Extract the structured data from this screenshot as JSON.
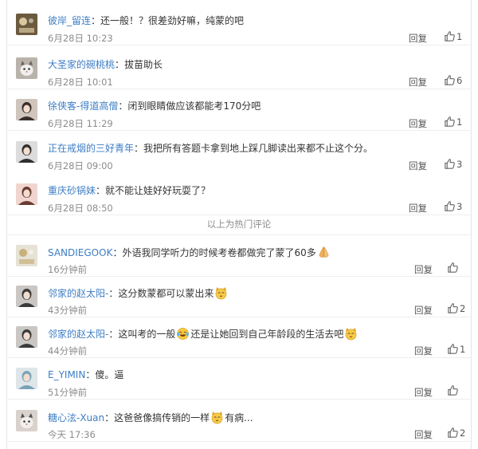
{
  "hot_label": "以上为热门评论",
  "reply_label": "回复",
  "comments": [
    {
      "user": "彼岸_留连",
      "sep": "：",
      "text": "还一般！？很差劲好嘛，纯蒙的吧",
      "text2": "",
      "time": "6月28日 10:23",
      "likes": "1",
      "emoji1": "",
      "emoji2": ""
    },
    {
      "user": "大圣家的碗桃桃",
      "sep": "：",
      "text": "拔苗助长",
      "text2": "",
      "time": "6月28日 10:01",
      "likes": "6",
      "emoji1": "",
      "emoji2": ""
    },
    {
      "user": "徐侠客-得道高僧",
      "sep": "：",
      "text": "闭到眼睛做应该都能考170分吧",
      "text2": "",
      "time": "6月28日 11:29",
      "likes": "1",
      "emoji1": "",
      "emoji2": ""
    },
    {
      "user": "正在戒烟的三好青年",
      "sep": "：",
      "text": "我把所有答题卡拿到地上踩几脚读出来都不止这个分。",
      "text2": "",
      "time": "6月28日 09:00",
      "likes": "3",
      "emoji1": "",
      "emoji2": ""
    },
    {
      "user": "重庆砂锅妹",
      "sep": "：",
      "text": "就不能让娃好好玩耍了？",
      "text2": "",
      "time": "6月28日 08:50",
      "likes": "3",
      "emoji1": "",
      "emoji2": ""
    },
    {
      "user": "SANDIEGOOK",
      "sep": "：",
      "text": "外语我同学听力的时候考卷都做完了蒙了60多",
      "text2": "",
      "time": "16分钟前",
      "likes": "",
      "emoji1": "pray-emoji",
      "emoji2": ""
    },
    {
      "user": "邻家的赵太阳-",
      "sep": "：",
      "text": "这分数蒙都可以蒙出来",
      "text2": "",
      "time": "43分钟前",
      "likes": "2",
      "emoji1": "cat-emoji",
      "emoji2": ""
    },
    {
      "user": "邻家的赵太阳-",
      "sep": "：",
      "text": "这叫考的一般",
      "text2": "还是让她回到自己年龄段的生活去吧",
      "time": "44分钟前",
      "likes": "1",
      "emoji1": "laugh-cry-emoji",
      "emoji2": "cat-emoji"
    },
    {
      "user": "E_YIMIN",
      "sep": "：",
      "text": "傻。逼",
      "text2": "",
      "time": "51分钟前",
      "likes": "",
      "emoji1": "",
      "emoji2": ""
    },
    {
      "user": "糖心泫-Xuan",
      "sep": "：",
      "text": "这爸爸像搞传销的一样",
      "text2": "有病...",
      "time": "今天 17:36",
      "likes": "2",
      "emoji1": "cat-emoji",
      "emoji2": ""
    }
  ]
}
